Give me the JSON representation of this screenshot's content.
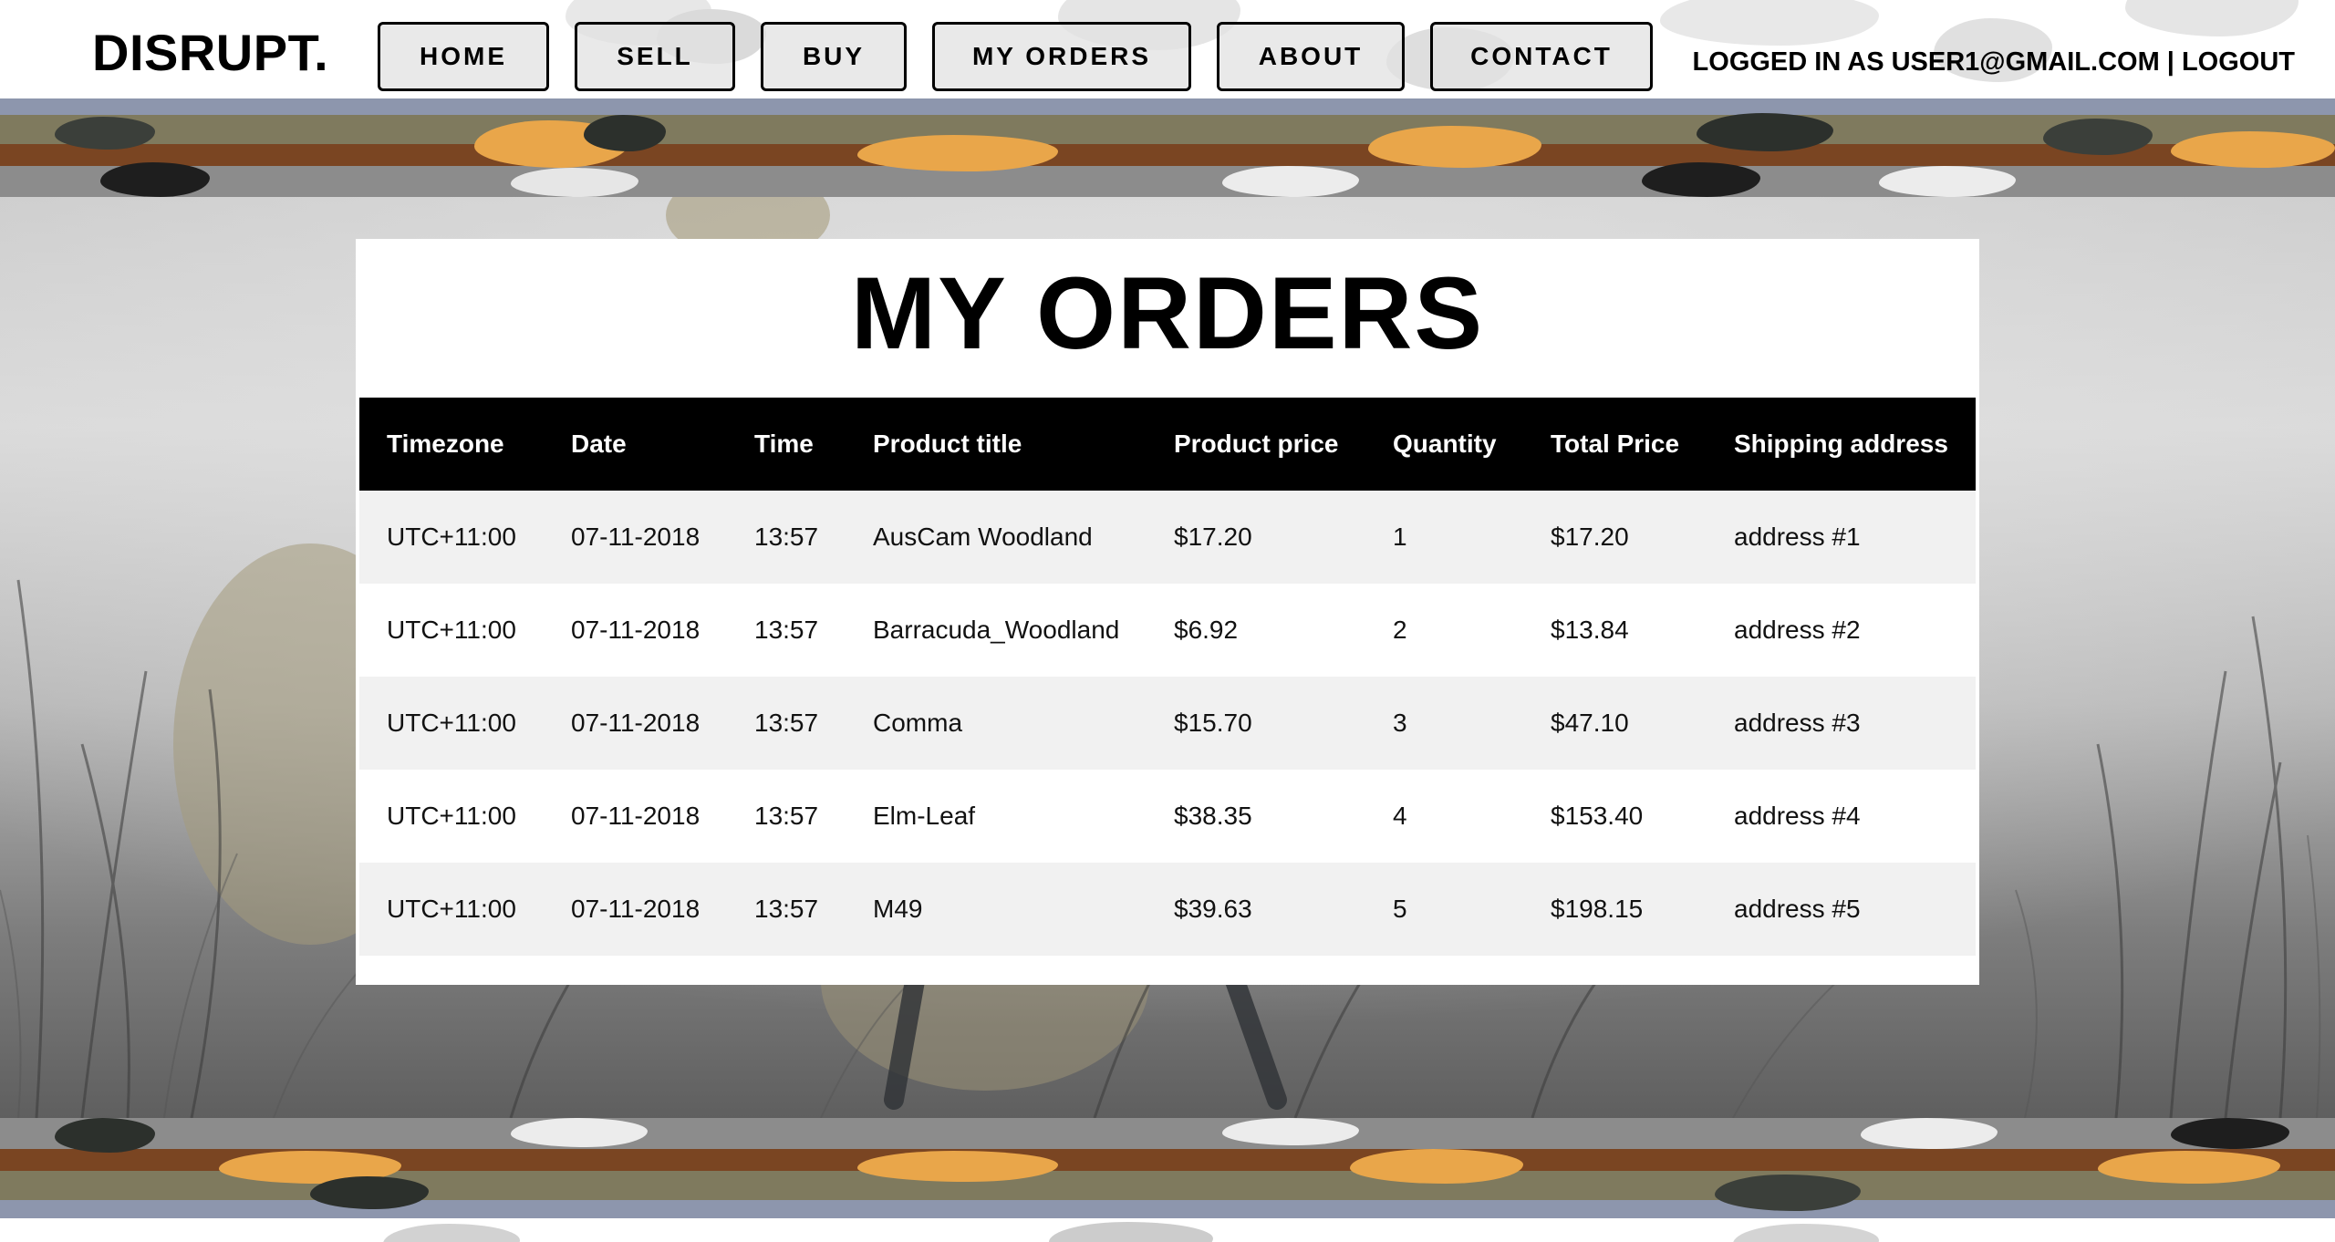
{
  "header": {
    "logo": "DISRUPT.",
    "nav": [
      {
        "label": "HOME"
      },
      {
        "label": "SELL"
      },
      {
        "label": "BUY"
      },
      {
        "label": "MY ORDERS"
      },
      {
        "label": "ABOUT"
      },
      {
        "label": "CONTACT"
      }
    ],
    "login_status": "LOGGED IN AS USER1@GMAIL.COM | LOGOUT"
  },
  "main": {
    "title": "MY ORDERS",
    "table": {
      "columns": [
        "Timezone",
        "Date",
        "Time",
        "Product title",
        "Product price",
        "Quantity",
        "Total Price",
        "Shipping address"
      ],
      "rows": [
        [
          "UTC+11:00",
          "07-11-2018",
          "13:57",
          "AusCam Woodland",
          "$17.20",
          "1",
          "$17.20",
          "address #1"
        ],
        [
          "UTC+11:00",
          "07-11-2018",
          "13:57",
          "Barracuda_Woodland",
          "$6.92",
          "2",
          "$13.84",
          "address #2"
        ],
        [
          "UTC+11:00",
          "07-11-2018",
          "13:57",
          "Comma",
          "$15.70",
          "3",
          "$47.10",
          "address #3"
        ],
        [
          "UTC+11:00",
          "07-11-2018",
          "13:57",
          "Elm-Leaf",
          "$38.35",
          "4",
          "$153.40",
          "address #4"
        ],
        [
          "UTC+11:00",
          "07-11-2018",
          "13:57",
          "M49",
          "$39.63",
          "5",
          "$198.15",
          "address #5"
        ]
      ]
    }
  },
  "colors": {
    "camo_orange": "#e9a64a",
    "camo_brown": "#7a4522",
    "camo_olive": "#7f7a5e",
    "camo_dark": "#2c302c",
    "camo_blue_gray": "#8d96ad",
    "header_bg": "#ffffff",
    "table_header_bg": "#000000",
    "row_alt_bg": "#f1f1f1"
  }
}
